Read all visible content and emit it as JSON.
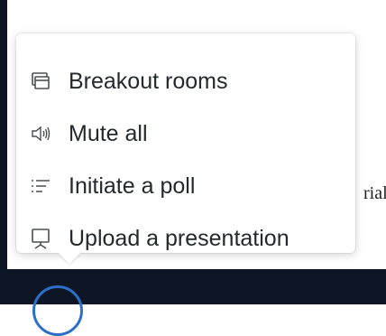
{
  "menu": {
    "items": [
      {
        "label": "Breakout rooms",
        "icon": "breakout-rooms-icon"
      },
      {
        "label": "Mute all",
        "icon": "speaker-icon"
      },
      {
        "label": "Initiate a poll",
        "icon": "list-icon"
      },
      {
        "label": "Upload a presentation",
        "icon": "presentation-icon"
      }
    ]
  },
  "background": {
    "partial_text": "rial"
  }
}
